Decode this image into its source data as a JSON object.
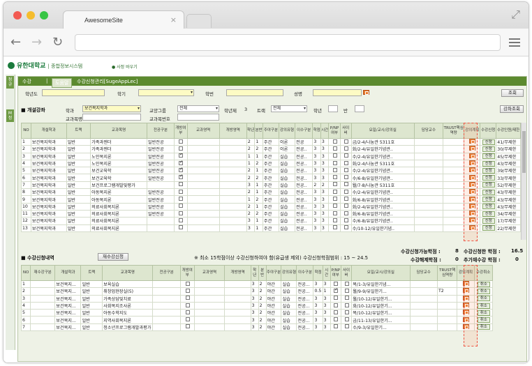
{
  "browser": {
    "tab_title": "AwesomeSite",
    "tab_close": "×",
    "back": "←",
    "forward": "→",
    "reload": "↻",
    "expand": "⤢"
  },
  "site": {
    "logo": "유한대학교",
    "logo_sub": "| 종합정보시스템",
    "sitemap": "● 사정 바우기",
    "side_btn1": "정규",
    "side_btn2": "M 정"
  },
  "header": {
    "crumb1": "수강",
    "crumb_sep": "|",
    "crumb_btn": "도움말",
    "crumb2": "수강신청관리[SugeAppLec]"
  },
  "filters": {
    "grade_label": "학년도",
    "term_label": "학기",
    "student_no_label": "학번",
    "name_label": "성명",
    "search_btn": "조회",
    "section_label": "■ 개설강좌",
    "dept_label": "학과",
    "dept_value": "보건복지학과",
    "area_label": "교양그룹",
    "area_value": "전체",
    "year_label": "학년제",
    "year_value": "3",
    "track_label": "트랙",
    "track_value": "전체",
    "grade2_label": "학년",
    "class_label": "반",
    "prof_label": "교과목명",
    "course_no_label": "교과목번호",
    "search2_btn": "강좌조회"
  },
  "open_table": {
    "headers": [
      "NO",
      "개설학과",
      "트랙",
      "교과목명",
      "전공구분",
      "개방여부",
      "교과영역",
      "개방영역",
      "학년",
      "분반",
      "주야구분",
      "강의유형",
      "이수구분",
      "학점",
      "시간",
      "P/NP여부",
      "사이버",
      "요일/교시/강의실",
      "담당교수",
      "TRUST핵심역량",
      "강의계획",
      "수강신청",
      "수강인원/제한"
    ],
    "rows": [
      [
        "1",
        "보건복지학과",
        "일반",
        "가족과젠더",
        "일반전공",
        "",
        "",
        "",
        "2",
        "1",
        "주간",
        "이론",
        "전공",
        "3",
        "3",
        "",
        "",
        "금/2-4/나눔관 5311호",
        "",
        "",
        "",
        "신청",
        "41/무제한"
      ],
      [
        "2",
        "보건복지학과",
        "일반",
        "가족과젠더",
        "일반전공",
        "",
        "",
        "",
        "2",
        "2",
        "주간",
        "이론",
        "전공..",
        "3",
        "3",
        "",
        "",
        "화/2-4/유일한기념관..",
        "",
        "",
        "",
        "신청",
        "30/무제한"
      ],
      [
        "3",
        "보건복지학과",
        "일반",
        "노인복지론",
        "일반전공",
        "v",
        "",
        "",
        "1",
        "1",
        "주간",
        "실습",
        "전공..",
        "3",
        "3",
        "",
        "",
        "수/2-4/유일한기념관..",
        "",
        "",
        "",
        "신청",
        "45/무제한"
      ],
      [
        "4",
        "보건복지학과",
        "일반",
        "노인복지론",
        "일반전공",
        "v",
        "",
        "",
        "1",
        "2",
        "주간",
        "실습",
        "전공..",
        "3",
        "3",
        "",
        "",
        "화/2-4/나눔관 5311호",
        "",
        "",
        "",
        "신청",
        "43/무제한"
      ],
      [
        "5",
        "보건복지학과",
        "일반",
        "보건교육학",
        "일반전공",
        "v",
        "",
        "",
        "2",
        "1",
        "주간",
        "실습",
        "전공..",
        "3",
        "3",
        "",
        "",
        "수/2-4/유일한기념관..",
        "",
        "",
        "",
        "신청",
        "39/무제한"
      ],
      [
        "6",
        "보건복지학과",
        "일반",
        "보건교육학",
        "일반전공",
        "v",
        "",
        "",
        "2",
        "2",
        "주간",
        "실습",
        "전공..",
        "3",
        "3",
        "",
        "",
        "수/6-8/유일한기념관..",
        "",
        "",
        "",
        "신청",
        "33/무제한"
      ],
      [
        "7",
        "보건복지학과",
        "일반",
        "보건프로그램개발및평가",
        "",
        "",
        "",
        "",
        "3",
        "1",
        "주간",
        "실습",
        "전공..",
        "2",
        "2",
        "",
        "",
        "월/7-8/나눔관 5311호",
        "",
        "",
        "",
        "신청",
        "52/무제한"
      ],
      [
        "8",
        "보건복지학과",
        "일반",
        "아동복지론",
        "일반전공",
        "",
        "",
        "",
        "2",
        "1",
        "주간",
        "실습",
        "전공..",
        "3",
        "3",
        "",
        "",
        "수/2-4/유일한기념관..",
        "",
        "",
        "",
        "신청",
        "43/무제한"
      ],
      [
        "9",
        "보건복지학과",
        "일반",
        "아동복지론",
        "일반전공",
        "",
        "",
        "",
        "1",
        "2",
        "주간",
        "실습",
        "전공..",
        "3",
        "3",
        "",
        "",
        "화/6-8/유일한기념관..",
        "",
        "",
        "",
        "신청",
        "43/무제한"
      ],
      [
        "10",
        "보건복지학과",
        "일반",
        "의료사회복지론",
        "일반전공",
        "",
        "",
        "",
        "2",
        "1",
        "주간",
        "실습",
        "전공..",
        "3",
        "3",
        "",
        "",
        "화/2-4/유일한기념관..",
        "",
        "",
        "",
        "신청",
        "43/무제한"
      ],
      [
        "11",
        "보건복지학과",
        "일반",
        "의료사회복지론",
        "일반전공",
        "",
        "",
        "",
        "2",
        "2",
        "주간",
        "실습",
        "전공..",
        "3",
        "3",
        "",
        "",
        "화/6-8/유일한기념관..",
        "",
        "",
        "",
        "신청",
        "34/무제한"
      ],
      [
        "12",
        "보건복지학과",
        "일반",
        "의료사회복지론",
        "",
        "",
        "",
        "",
        "3",
        "1",
        "주간",
        "실습",
        "전공..",
        "3",
        "3",
        "",
        "",
        "수/6-8/유일한기념관..",
        "",
        "",
        "",
        "신청",
        "17/무제한"
      ],
      [
        "13",
        "보건복지학과",
        "일반",
        "의료사회복지론",
        "",
        "",
        "",
        "",
        "3",
        "1",
        "주간",
        "실습",
        "전공..",
        "3",
        "3",
        "",
        "",
        "수/10-12/유일한기념..",
        "",
        "",
        "",
        "신청",
        "22/무제한"
      ]
    ]
  },
  "applied": {
    "section_label": "■ 수강신청내역",
    "recalc_btn": "재수강신청",
    "notice": "※ 최소 15학점이상 수강신청하여야 함(유급생 제외) 수강신청학점범위 : 15 ~ 24.5",
    "avail_label": "수강신청가능학점 :",
    "avail_value": "8",
    "applied_label": "수강신청한 학점 :",
    "applied_value": "16.5",
    "excess_label": "수강해제학점 :",
    "excess_value": "0",
    "extra_label": "추가재수강 학점 :",
    "extra_value": "0",
    "headers": [
      "NO",
      "재수강구분",
      "개설학과",
      "트랙",
      "교과목명",
      "전공구분",
      "개방여부",
      "교과영역",
      "개방영역",
      "학년",
      "분반",
      "주야구분",
      "강의유형",
      "이수구분",
      "학점",
      "시간",
      "P/NP여부",
      "사이버",
      "요일/교시/강의실",
      "담당교수",
      "TRUST핵심역량",
      "강의계획",
      "수강취소"
    ],
    "rows": [
      [
        "1",
        "",
        "보건복지...",
        "일반",
        "보육실습",
        "",
        "",
        "",
        "",
        "3",
        "2",
        "야간",
        "실습",
        "전공...",
        "3",
        "3",
        "",
        "",
        "목/1-3/유일한기념...",
        "",
        "",
        "",
        "취소"
      ],
      [
        "2",
        "",
        "보건복지...",
        "일반",
        "취창업현장실(5)",
        "",
        "",
        "",
        "",
        "3",
        "2",
        "야간",
        "실습",
        "전공...",
        "0.5",
        "1",
        "v",
        "",
        "월/9-9/유일한기...",
        "",
        "T2",
        "",
        "취소"
      ],
      [
        "3",
        "",
        "보건복지...",
        "일반",
        "가족상담및치료",
        "",
        "",
        "",
        "",
        "3",
        "2",
        "야간",
        "실습",
        "전공...",
        "3",
        "3",
        "",
        "",
        "월/10-12/유일한기...",
        "",
        "",
        "",
        "취소"
      ],
      [
        "4",
        "",
        "보건복지...",
        "일반",
        "사회복지조사론",
        "",
        "",
        "",
        "",
        "3",
        "2",
        "야간",
        "실습",
        "전공...",
        "3",
        "3",
        "",
        "",
        "화/10-12/유일한기...",
        "",
        "",
        "",
        "취소"
      ],
      [
        "5",
        "",
        "보건복지...",
        "일반",
        "아동수학지도",
        "",
        "",
        "",
        "",
        "3",
        "2",
        "야간",
        "실습",
        "전공...",
        "3",
        "3",
        "",
        "",
        "목/10-12/유일한기...",
        "",
        "",
        "",
        "취소"
      ],
      [
        "6",
        "",
        "보건복지...",
        "일반",
        "지역사회복지론",
        "",
        "",
        "",
        "",
        "3",
        "2",
        "야간",
        "실습",
        "전공...",
        "3",
        "3",
        "",
        "",
        "금/11-13/유일한기...",
        "",
        "",
        "",
        "취소"
      ],
      [
        "7",
        "",
        "보건복지...",
        "일반",
        "청소년프로그램개발과평가",
        "",
        "",
        "",
        "",
        "3",
        "2",
        "야간",
        "실습",
        "전공...",
        "3",
        "3",
        "",
        "",
        "수/9-3/유일한기...",
        "",
        "",
        "",
        "취소"
      ]
    ]
  },
  "colors": {
    "brand": "#5c8a2f",
    "accent": "#e87a2a",
    "highlight": "#e54444"
  },
  "icons": {
    "search": "search-icon",
    "checkbox": "checkbox-icon",
    "plan": "syllabus-icon"
  }
}
